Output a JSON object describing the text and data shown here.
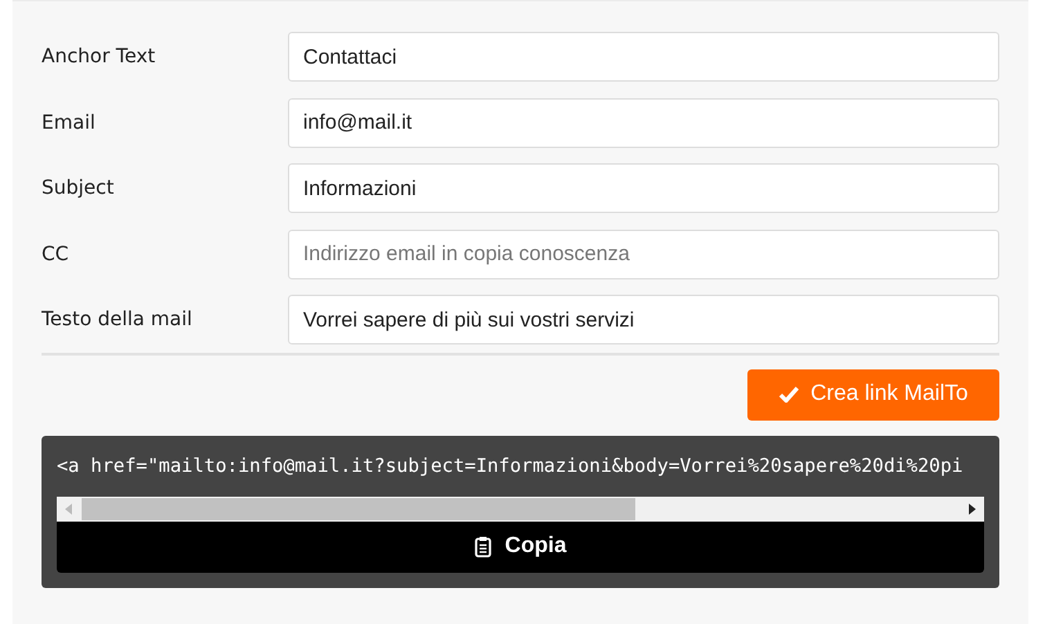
{
  "form": {
    "fields": [
      {
        "label": "Anchor Text",
        "value": "Contattaci"
      },
      {
        "label": "Email",
        "value": "info@mail.it"
      },
      {
        "label": "Subject",
        "value": "Informazioni"
      },
      {
        "label": "CC",
        "placeholder": "Indirizzo email in copia conoscenza"
      },
      {
        "label": "Testo della mail",
        "value": "Vorrei sapere di più sui vostri servizi"
      }
    ],
    "submit_button": "Crea link MailTo"
  },
  "output": {
    "code": "<a href=\"mailto:info@mail.it?subject=Informazioni&body=Vorrei%20sapere%20di%20pi",
    "copy_button": "Copia"
  }
}
